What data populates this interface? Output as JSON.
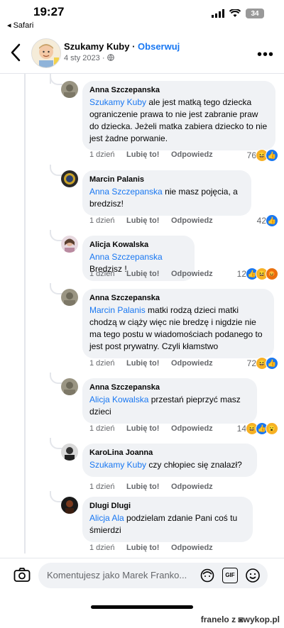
{
  "status_bar": {
    "time": "19:27",
    "back_app": "◂ Safari",
    "battery": "34"
  },
  "header": {
    "page_name": "Szukamy Kuby",
    "separator": " · ",
    "follow_label": "Obserwuj",
    "post_date": "4 sty 2023 · "
  },
  "comments": [
    {
      "author": "Anna Szczepanska",
      "mention": "Szukamy Kuby",
      "text": " ale jest matką tego dziecka ograniczenie prawa to nie jest zabranie praw do dziecka. Jeżeli matka zabiera dziecko to nie jest żadne porwanie.",
      "time": "1 dzień",
      "like": "Lubię to!",
      "reply": "Odpowiedz",
      "reaction_count": "76",
      "reactions": [
        "haha",
        "like"
      ]
    },
    {
      "author": "Marcin Palanis",
      "mention": "Anna Szczepanska",
      "text": " nie masz pojęcia, a bredzisz!",
      "time": "1 dzień",
      "like": "Lubię to!",
      "reply": "Odpowiedz",
      "reaction_count": "42",
      "reactions": [
        "like"
      ]
    },
    {
      "author": "Alicja Kowalska",
      "mention": "Anna Szczepanska",
      "text": " Bredzisz !",
      "time": "1 dzień",
      "like": "Lubię to!",
      "reply": "Odpowiedz",
      "reaction_count": "12",
      "reactions": [
        "like",
        "haha",
        "angry"
      ]
    },
    {
      "author": "Anna Szczepanska",
      "mention": "Marcin Palanis",
      "text": " matki rodzą dzieci matki chodzą w ciąży więc nie bredzę i nigdzie nie ma tego postu w wiadomościach podanego to jest post prywatny. Czyli kłamstwo",
      "time": "1 dzień",
      "like": "Lubię to!",
      "reply": "Odpowiedz",
      "reaction_count": "72",
      "reactions": [
        "haha",
        "like"
      ]
    },
    {
      "author": "Anna Szczepanska",
      "mention": "Alicja Kowalska",
      "text": " przestań pieprzyć masz dzieci",
      "time": "1 dzień",
      "like": "Lubię to!",
      "reply": "Odpowiedz",
      "reaction_count": "14",
      "reactions": [
        "haha",
        "like",
        "wow"
      ]
    },
    {
      "author": "KaroLina Joanna",
      "mention": "Szukamy Kuby",
      "text": " czy chłopiec się znalazł?",
      "time": "1 dzień",
      "like": "Lubię to!",
      "reply": "Odpowiedz",
      "reaction_count": "",
      "reactions": []
    },
    {
      "author": "Dlugi Dlugi",
      "mention": "Alicja Ala",
      "text": " podzielam zdanie Pani coś tu śmierdzi",
      "time": "1 dzień",
      "like": "Lubię to!",
      "reply": "Odpowiedz",
      "reaction_count": "",
      "reactions": []
    }
  ],
  "composer": {
    "placeholder": "Komentujesz jako Marek Franko...",
    "gif_label": "GIF"
  },
  "footer": {
    "watermark": "franelo z ◙wykop.pl"
  },
  "colors": {
    "accent": "#1877f2",
    "bubble": "#f0f2f5",
    "meta": "#65676b"
  }
}
